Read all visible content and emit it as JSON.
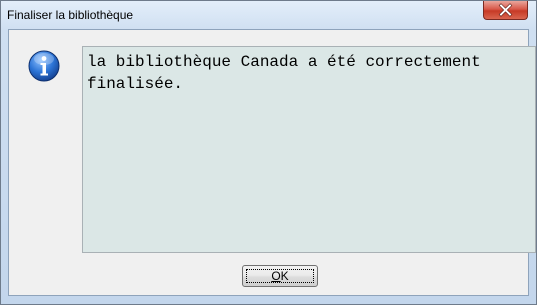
{
  "window": {
    "title": "Finaliser la bibliothèque",
    "close_icon": "close-icon"
  },
  "dialog": {
    "icon": "info-icon",
    "message": "la bibliothèque Canada a été correctement finalisée.",
    "ok_mnemonic": "O",
    "ok_rest": "K"
  },
  "colors": {
    "close_button": "#c73a26",
    "message_background": "#dbe7e6",
    "info_icon": "#1f5fbf"
  }
}
